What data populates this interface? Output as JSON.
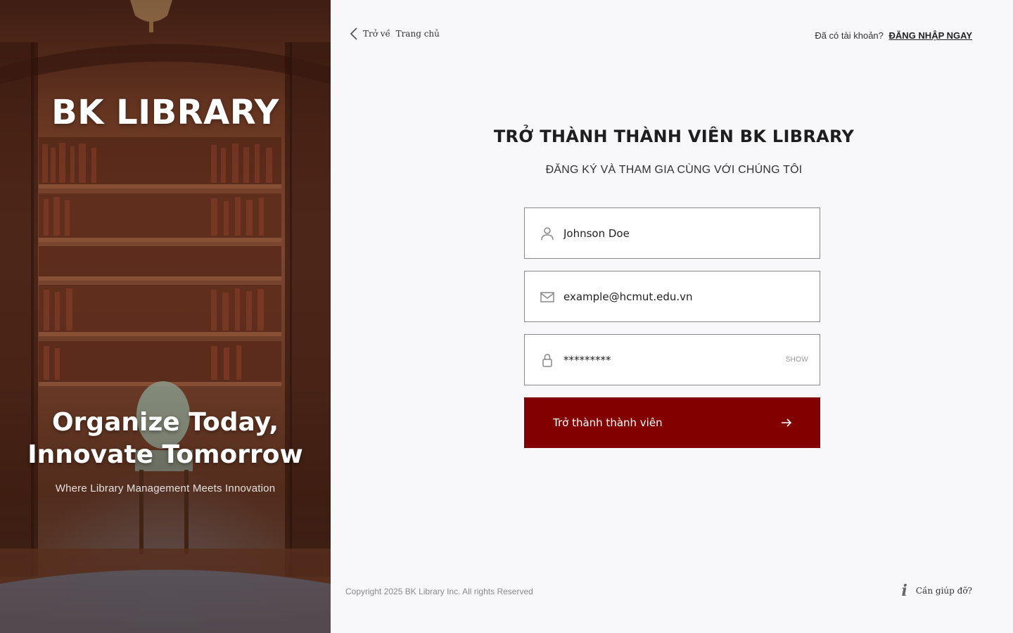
{
  "hero": {
    "brand": "BK LIBRARY",
    "tagline_line1": "Organize Today,",
    "tagline_line2": "Innovate Tomorrow",
    "subtagline": "Where Library Management Meets Innovation"
  },
  "header": {
    "back_label": "Trở về  Trang chủ",
    "login_prompt": "Đã có tài khoản?",
    "login_link": "ĐĂNG NHẬP NGAY"
  },
  "form": {
    "title": "TRỞ THÀNH THÀNH VIÊN BK LIBRARY",
    "subtitle": "ĐĂNG KÝ VÀ THAM GIA CÙNG VỚI CHÚNG TÔI",
    "name_value": "Johnson Doe",
    "email_value": "example@hcmut.edu.vn",
    "password_value": "*********",
    "show_label": "SHOW",
    "submit_label": "Trở thành thành viên"
  },
  "footer": {
    "copyright": "Copyright 2025 BK Library Inc. All rights Reserved",
    "help_label": "Cần giúp đỡ?"
  },
  "icons": {
    "name_field": "user-icon",
    "email_field": "mail-icon",
    "password_field": "lock-icon",
    "back": "chevron-left-icon",
    "submit": "arrow-right-icon",
    "help": "info-icon"
  },
  "colors": {
    "accent": "#820000",
    "page_bg": "#f8f8fa",
    "field_border": "#8a8a8a"
  }
}
